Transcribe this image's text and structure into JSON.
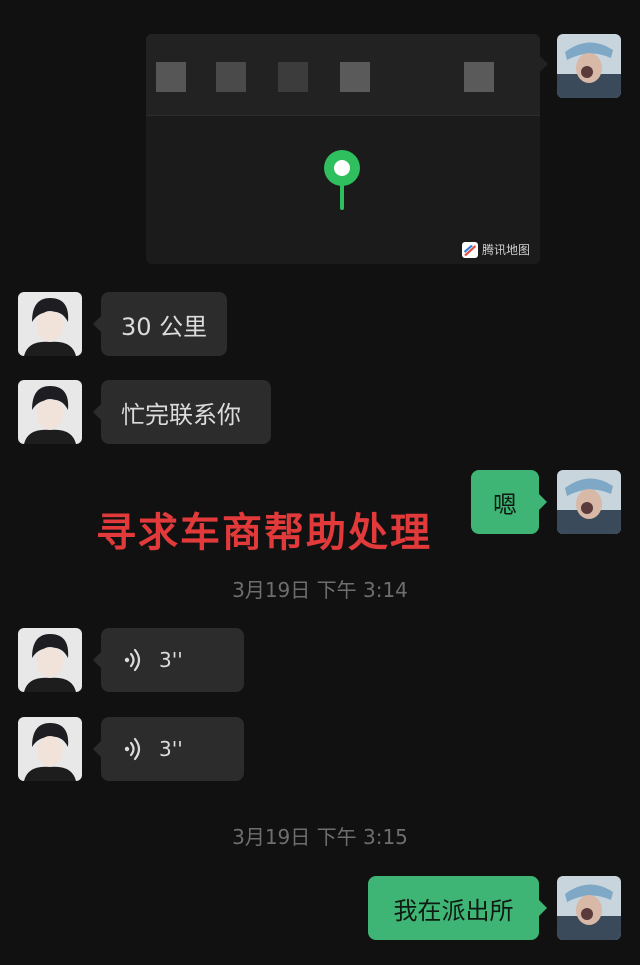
{
  "map_card": {
    "attribution": "腾讯地图"
  },
  "messages": [
    {
      "id": "m1",
      "side": "in",
      "type": "text",
      "text": "30 公里"
    },
    {
      "id": "m2",
      "side": "in",
      "type": "text",
      "text": "忙完联系你"
    },
    {
      "id": "m3",
      "side": "out",
      "type": "text",
      "text": "嗯"
    },
    {
      "id": "m4",
      "side": "in",
      "type": "voice",
      "duration": "3''"
    },
    {
      "id": "m5",
      "side": "in",
      "type": "voice",
      "duration": "3''"
    },
    {
      "id": "m6",
      "side": "out",
      "type": "text",
      "text": "我在派出所"
    }
  ],
  "timestamps": [
    "3月19日 下午 3:14",
    "3月19日 下午 3:15"
  ],
  "overlay_caption": "寻求车商帮助处理",
  "colors": {
    "background": "#111111",
    "incoming_bubble": "#2c2c2c",
    "outgoing_bubble": "#3eb575",
    "pin": "#2fbf5f",
    "overlay_text": "#e23a3a"
  },
  "icons": {
    "location_pin": "location-pin-icon",
    "voice": "voice-wave-icon",
    "map_logo": "tencent-map-logo-icon"
  }
}
